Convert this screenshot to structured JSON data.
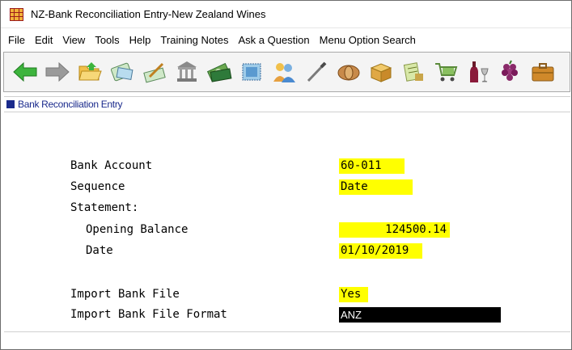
{
  "window": {
    "title": "NZ-Bank Reconciliation Entry-New Zealand Wines"
  },
  "menu": {
    "items": [
      {
        "label": "File"
      },
      {
        "label": "Edit"
      },
      {
        "label": "View"
      },
      {
        "label": "Tools"
      },
      {
        "label": "Help"
      },
      {
        "label": "Training Notes"
      },
      {
        "label": "Ask a Question"
      },
      {
        "label": "Menu Option Search"
      }
    ]
  },
  "toolbar": {
    "icons": [
      "back-arrow-icon",
      "forward-arrow-icon",
      "folder-icon",
      "checkbook-icon",
      "pen-signing-icon",
      "bank-building-icon",
      "money-icon",
      "stamp-icon",
      "people-icon",
      "pen-icon",
      "barrel-icon",
      "box-icon",
      "cash-icon",
      "cart-icon",
      "wine-bottle-icon",
      "grapes-icon",
      "briefcase-icon"
    ]
  },
  "panel": {
    "title": "Bank Reconciliation Entry"
  },
  "form": {
    "bank_account": {
      "label": "Bank Account",
      "value": "60-011"
    },
    "sequence": {
      "label": "Sequence",
      "value": "Date"
    },
    "statement": {
      "label": "Statement:"
    },
    "opening_balance": {
      "label": "Opening Balance",
      "value": "124500.14"
    },
    "date": {
      "label": "Date",
      "value": "01/10/2019"
    },
    "import_bank_file": {
      "label": "Import Bank File",
      "value": "Yes"
    },
    "import_bank_file_format": {
      "label": "Import Bank File Format",
      "value": "ANZ"
    }
  },
  "colors": {
    "field_highlight": "#ffff00",
    "active_field": "#000000",
    "panel_header": "#1a2a8c"
  }
}
